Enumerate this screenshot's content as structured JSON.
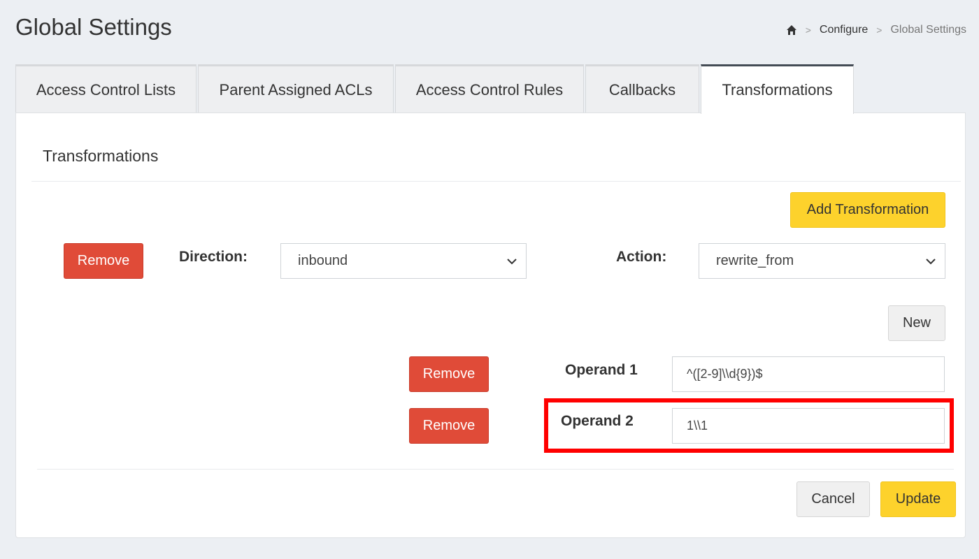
{
  "header": {
    "title": "Global Settings",
    "breadcrumb": {
      "home_icon": "home-icon",
      "separator": ">",
      "configure": "Configure",
      "current": "Global Settings"
    }
  },
  "tabs": [
    {
      "label": "Access Control Lists",
      "active": false
    },
    {
      "label": "Parent Assigned ACLs",
      "active": false
    },
    {
      "label": "Access Control Rules",
      "active": false
    },
    {
      "label": "Callbacks",
      "active": false
    },
    {
      "label": "Transformations",
      "active": true
    }
  ],
  "panel": {
    "title": "Transformations",
    "add_button": "Add Transformation",
    "transformation": {
      "remove_label": "Remove",
      "direction_label": "Direction:",
      "direction_value": "inbound",
      "action_label": "Action:",
      "action_value": "rewrite_from",
      "new_button": "New",
      "operands": [
        {
          "remove_label": "Remove",
          "label": "Operand 1",
          "value": "^([2-9]\\\\d{9})$"
        },
        {
          "remove_label": "Remove",
          "label": "Operand 2",
          "value": "1\\\\1"
        }
      ]
    },
    "cancel_button": "Cancel",
    "update_button": "Update"
  },
  "colors": {
    "accent_yellow": "#fdd22c",
    "danger_red": "#e04b38",
    "highlight_red": "#ff0000"
  }
}
